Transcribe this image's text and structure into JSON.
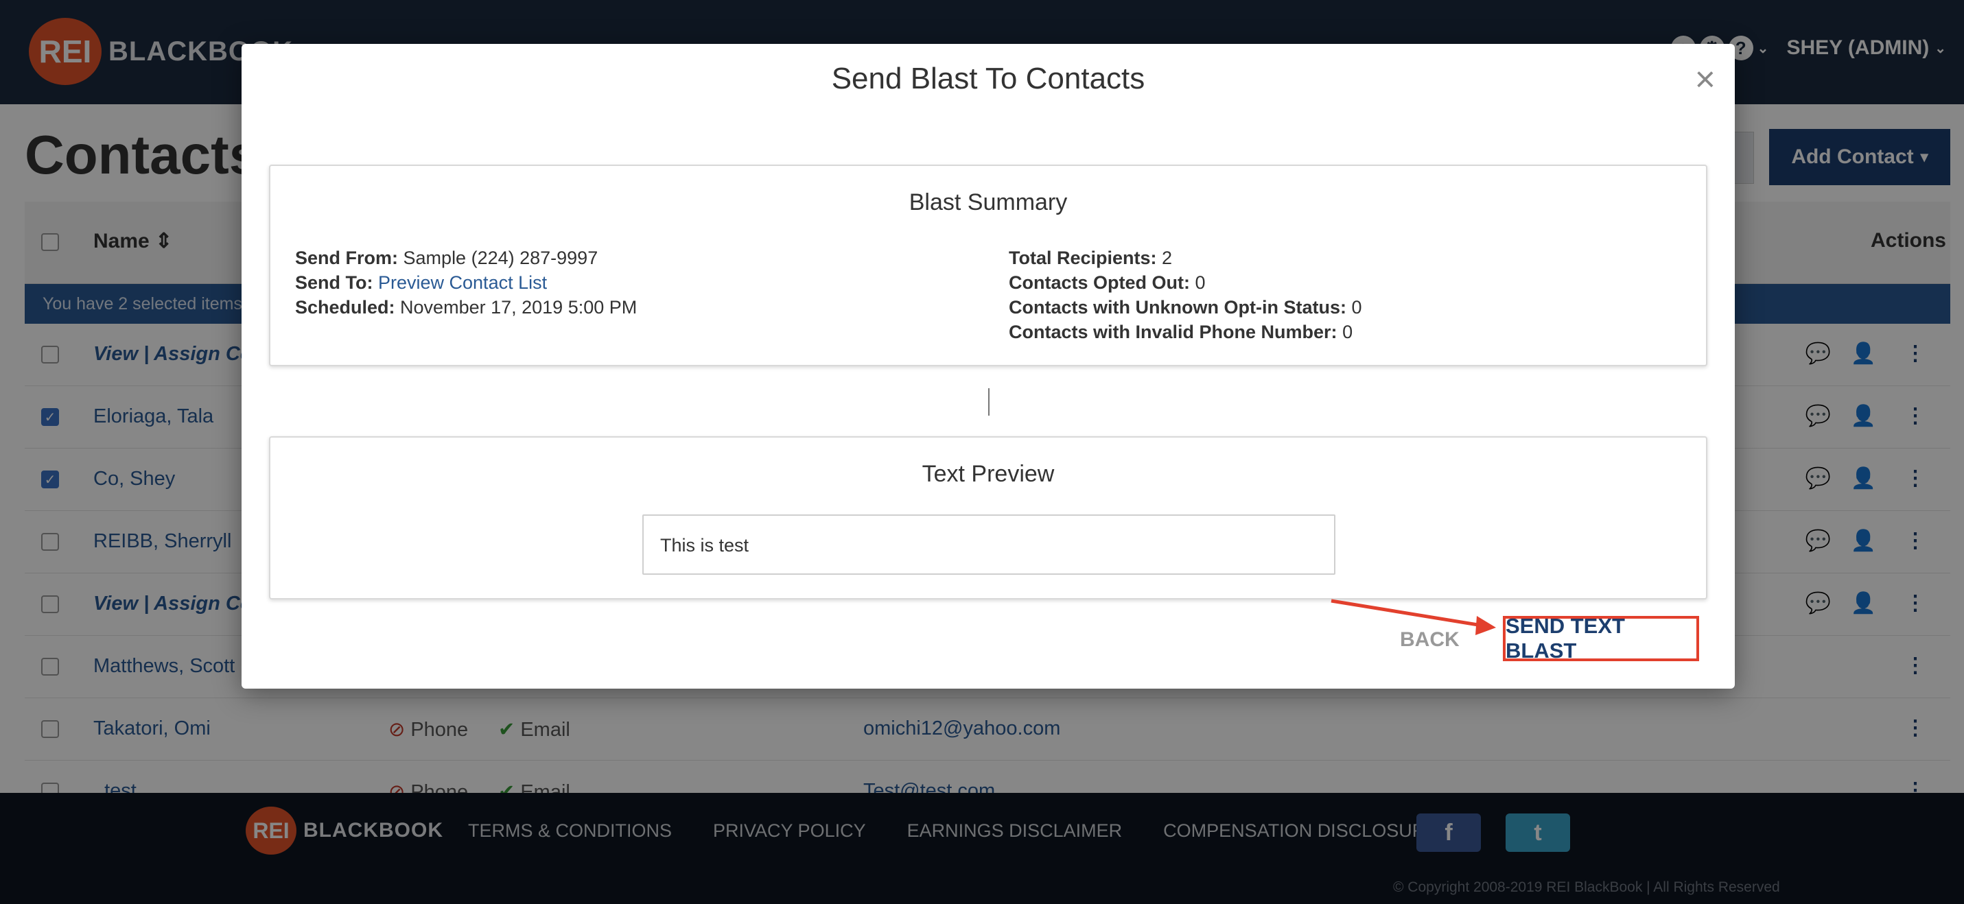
{
  "nav": {
    "logo_mark": "REI",
    "logo_word": "BLACKBOOK",
    "icons": [
      "bell-icon",
      "gear-icon",
      "help-icon"
    ],
    "user": "SHEY (ADMIN)"
  },
  "page": {
    "title": "Contacts",
    "add_contact_label": "Add Contact"
  },
  "table": {
    "headers": {
      "name": "Name",
      "actions": "Actions"
    },
    "selection_banner": "You have 2 selected items",
    "rows": [
      {
        "name": "View | Assign Con",
        "italic": true,
        "checked": false,
        "phone": "",
        "email": "",
        "email_address": "",
        "actions": true
      },
      {
        "name": "Eloriaga, Tala",
        "italic": false,
        "checked": true,
        "phone": "",
        "email": "",
        "email_address": "",
        "actions": true
      },
      {
        "name": "Co, Shey",
        "italic": false,
        "checked": true,
        "phone": "",
        "email": "",
        "email_address": "",
        "actions": true
      },
      {
        "name": "REIBB, Sherryll",
        "italic": false,
        "checked": false,
        "phone": "",
        "email": "",
        "email_address": "",
        "actions": true
      },
      {
        "name": "View | Assign Con",
        "italic": true,
        "checked": false,
        "phone": "",
        "email": "",
        "email_address": "",
        "actions": true
      },
      {
        "name": "Matthews, Scott",
        "italic": false,
        "checked": false,
        "phone": "",
        "email": "",
        "email_address": "",
        "actions": false
      },
      {
        "name": "Takatori, Omi",
        "italic": false,
        "checked": false,
        "phone": "Phone",
        "email": "Email",
        "email_address": "omichi12@yahoo.com",
        "actions": false
      },
      {
        "name": ", test",
        "italic": false,
        "checked": false,
        "phone": "Phone",
        "email": "Email",
        "email_address": "Test@test.com",
        "actions": false
      }
    ]
  },
  "modal": {
    "title": "Send Blast To Contacts",
    "close_glyph": "×",
    "summary": {
      "title": "Blast Summary",
      "send_from_label": "Send From:",
      "send_from_value": "Sample (224) 287-9997",
      "send_to_label": "Send To:",
      "send_to_value": "Preview Contact List",
      "scheduled_label": "Scheduled:",
      "scheduled_value": "November 17, 2019 5:00 PM",
      "total_recipients_label": "Total Recipients:",
      "total_recipients_value": "2",
      "opted_out_label": "Contacts Opted Out:",
      "opted_out_value": "0",
      "unknown_optin_label": "Contacts with Unknown Opt-in Status:",
      "unknown_optin_value": "0",
      "invalid_phone_label": "Contacts with Invalid Phone Number:",
      "invalid_phone_value": "0"
    },
    "preview": {
      "title": "Text Preview",
      "message": "This is test"
    },
    "back_label": "BACK",
    "send_label": "SEND TEXT BLAST",
    "annotation_color": "#e2402d"
  },
  "footer": {
    "logo_mark": "REI",
    "logo_word": "BLACKBOOK",
    "links": [
      "TERMS & CONDITIONS",
      "PRIVACY POLICY",
      "EARNINGS DISCLAIMER",
      "COMPENSATION DISCLOSURE"
    ],
    "copyright": "© Copyright 2008-2019 REI BlackBook | All Rights Reserved"
  }
}
